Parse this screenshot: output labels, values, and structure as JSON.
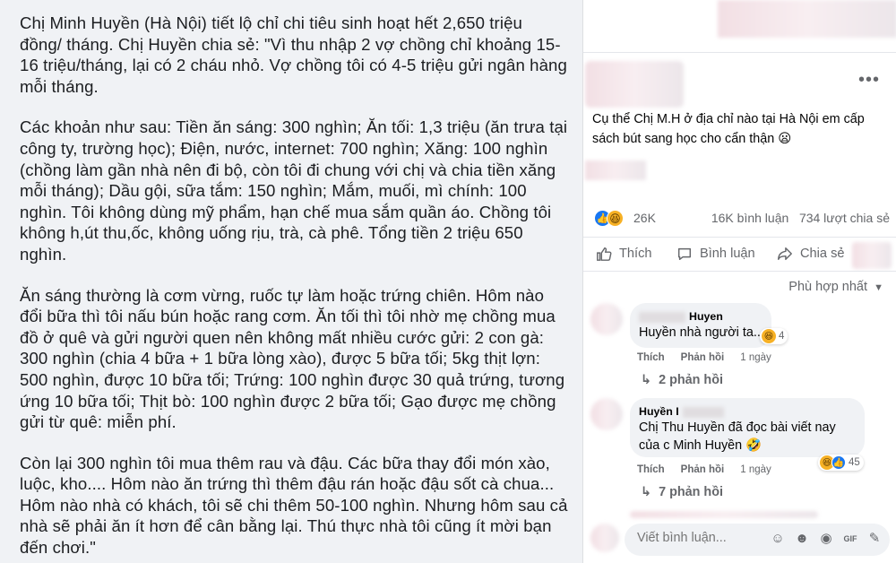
{
  "post_text": {
    "paragraphs": [
      "Chị Minh Huyền (Hà Nội) tiết lộ chỉ chi tiêu sinh hoạt hết 2,650 triệu đồng/ tháng. Chị Huyền chia sẻ: \"Vì thu nhập 2 vợ chồng chỉ khoảng 15-16 triệu/tháng, lại có 2 cháu nhỏ. Vợ chồng tôi có 4-5 triệu gửi ngân hàng mỗi tháng.",
      "Các khoản như sau: Tiền ăn sáng: 300 nghìn; Ăn tối: 1,3 triệu (ăn trưa tại công ty, trường học); Điện, nước, internet: 700 nghìn; Xăng: 100 nghìn (chồng làm gần nhà nên đi bộ, còn tôi đi chung với chị và chia tiền xăng mỗi tháng); Dầu gội, sữa tắm: 150 nghìn; Mắm, muối, mì chính: 100 nghìn. Tôi không dùng mỹ phẩm, hạn chế mua sắm quần áo. Chồng tôi không h,út thu,ốc, không uống rịu, trà, cà phê. Tổng tiền 2 triệu 650 nghìn.",
      "Ăn sáng thường là cơm vừng, ruốc tự làm hoặc trứng chiên. Hôm nào đổi bữa thì tôi nấu bún hoặc rang cơm. Ăn tối thì tôi nhờ mẹ chồng mua đồ ở quê và gửi người quen nên không mất nhiều cước gửi: 2 con gà: 300 nghìn (chia 4 bữa + 1 bữa lòng xào), được 5 bữa tối; 5kg thịt lợn: 500 nghìn, được 10 bữa tối; Trứng: 100 nghìn được 30 quả trứng, tương ứng 10 bữa tối; Thịt bò: 100 nghìn được 2 bữa tối; Gạo được mẹ chồng gửi từ quê: miễn phí.",
      "Còn lại 300 nghìn tôi mua thêm rau và đậu. Các bữa thay đổi món xào, luộc, kho.... Hôm nào ăn trứng thì thêm đậu rán hoặc đậu sốt cà chua... Hôm nào nhà có khách, tôi sẽ chi thêm 50-100 nghìn. Nhưng hôm sau cả nhà sẽ phải ăn ít hơn để cân bằng lại. Thú thực nhà tôi cũng ít mời bạn đến chơi.\""
    ]
  },
  "fb": {
    "more": "•••",
    "caption": "Cụ thể Chị M.H ở địa chỉ nào tại Hà Nội em cấp sách bút sang học cho cẩn thận 😦",
    "reactions": {
      "count": "26K",
      "comments": "16K bình luận",
      "shares": "734 lượt chia sẻ"
    },
    "actions": {
      "like": "Thích",
      "comment": "Bình luận",
      "share": "Chia sẻ"
    },
    "sort_label": "Phù hợp nhất",
    "comments": [
      {
        "name": "Huyen",
        "text": "Huyền nhà người ta..",
        "react_count": "4",
        "like": "Thích",
        "reply": "Phản hồi",
        "time": "1 ngày",
        "replies": "2 phản hồi"
      },
      {
        "name": "Huyền I",
        "text_line1": "Chị Thu Huyền đã đọc bài viết nay",
        "text_line2": "của c Minh Huyền 🤣",
        "react_count": "45",
        "like": "Thích",
        "reply": "Phản hồi",
        "time": "1 ngày",
        "replies": "7 phản hồi"
      }
    ],
    "comment_box": {
      "placeholder": "Viết bình luận..."
    },
    "colors": {
      "accent": "#1877f2",
      "haha": "#f7b125",
      "muted": "#65676b",
      "bubble": "#f0f2f5"
    }
  }
}
